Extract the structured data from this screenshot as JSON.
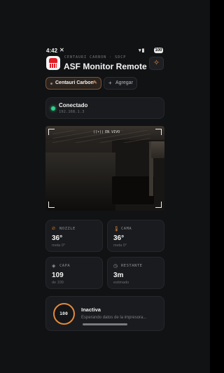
{
  "status_bar": {
    "time": "4:42",
    "battery": "100"
  },
  "header": {
    "subtitle": "CENTAURI CARBON · SDCP",
    "title": "ASF Monitor Remote"
  },
  "printer_tabs": {
    "active": "Centauri Carbon",
    "add_label": "Agregar"
  },
  "connection": {
    "status": "Conectado",
    "ip": "192.168.1.3"
  },
  "camera": {
    "live_label": "EN VIVO"
  },
  "stats": {
    "nozzle": {
      "label": "NOZZLE",
      "value": "36°",
      "sub": "meta 0°"
    },
    "bed": {
      "label": "CAMA",
      "value": "36°",
      "sub": "meta 0°"
    },
    "layer": {
      "label": "CAPA",
      "value": "109",
      "sub": "de 109"
    },
    "remaining": {
      "label": "RESTANTE",
      "value": "3m",
      "sub": "estimado"
    }
  },
  "progress": {
    "percent": "100",
    "state": "Inactiva",
    "message": "Esperando datos de la impresora..."
  },
  "colors": {
    "accent": "#e2893b",
    "connected": "#2fd38d",
    "background": "#111214"
  }
}
